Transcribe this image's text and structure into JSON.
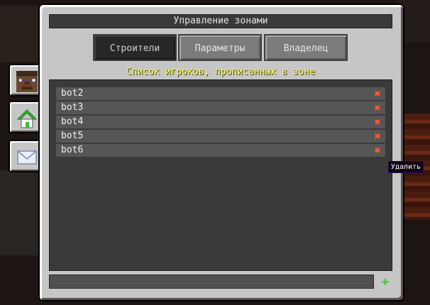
{
  "window": {
    "title": "Управление зонами"
  },
  "tabs": [
    {
      "label": "Строители",
      "active": true
    },
    {
      "label": "Параметры",
      "active": false
    },
    {
      "label": "Владелец",
      "active": false
    }
  ],
  "players_section": {
    "title": "Список игроков, прописанных в зоне",
    "players": [
      "bot2",
      "bot3",
      "bot4",
      "bot5",
      "bot6"
    ],
    "delete_icon": "red-x-icon"
  },
  "tooltip": {
    "text": "Удалить"
  },
  "bottom": {
    "input_value": "",
    "add_icon": "green-plus-icon"
  },
  "side_tabs": [
    {
      "icon": "player-head-icon"
    },
    {
      "icon": "house-icon",
      "active": true
    },
    {
      "icon": "mail-icon"
    }
  ],
  "colors": {
    "accent_yellow": "#ffff55",
    "delete_red": "#ff5a2e",
    "add_green": "#3bd13b"
  }
}
